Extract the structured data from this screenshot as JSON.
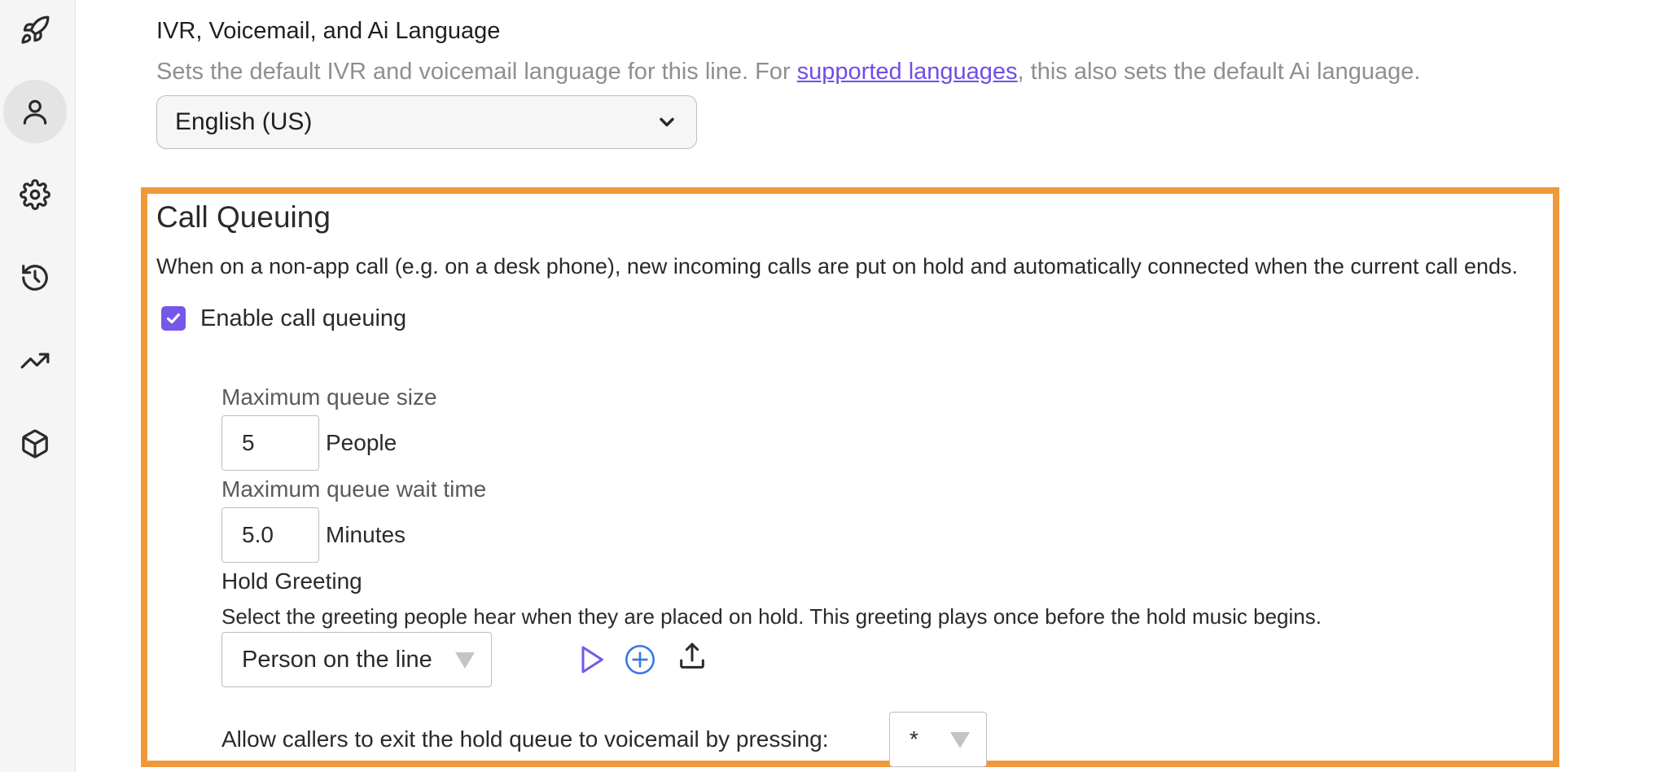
{
  "sidebar": {
    "icons": [
      "rocket-icon",
      "user-icon",
      "gear-icon",
      "history-icon",
      "trending-icon",
      "cube-icon"
    ],
    "active": "user-icon"
  },
  "language": {
    "title": "IVR, Voicemail, and Ai Language",
    "desc_before": "Sets the default IVR and voicemail language for this line. For ",
    "desc_link": "supported languages",
    "desc_after": ", this also sets the default Ai language.",
    "selected": "English (US)"
  },
  "call_queuing": {
    "title": "Call Queuing",
    "description": "When on a non-app call (e.g. on a desk phone), new incoming calls are put on hold and automatically connected when the current call ends.",
    "enable_label": "Enable call queuing",
    "enabled": true,
    "max_size_label": "Maximum queue size",
    "max_size_value": "5",
    "max_size_unit": "People",
    "max_wait_label": "Maximum queue wait time",
    "max_wait_value": "5.0",
    "max_wait_unit": "Minutes",
    "hold_greeting_title": "Hold Greeting",
    "hold_greeting_desc": "Select the greeting people hear when they are placed on hold. This greeting plays once before the hold music begins.",
    "hold_greeting_selected": "Person on the line",
    "exit_label": "Allow callers to exit the hold queue to voicemail by pressing:",
    "exit_key": "*"
  },
  "colors": {
    "accent": "#7657e8",
    "highlight_border": "#f0993a",
    "link": "#6f4ee6",
    "add_icon": "#3a7be0"
  }
}
